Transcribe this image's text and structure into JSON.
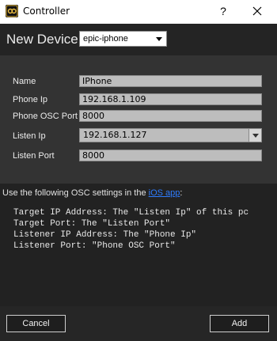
{
  "window": {
    "title": "Controller",
    "help_symbol": "?",
    "icons": {
      "app": "app-logo-icon",
      "close": "close-icon"
    }
  },
  "device": {
    "label": "New Device:",
    "selected": "epic-iphone"
  },
  "form": {
    "name_label": "Name",
    "name_value": "IPhone",
    "phone_ip_label": "Phone Ip",
    "phone_ip_value": "192.168.1.109",
    "phone_osc_port_label": "Phone OSC Port",
    "phone_osc_port_value": "8000",
    "listen_ip_label": "Listen Ip",
    "listen_ip_value": "192.168.1.127",
    "listen_port_label": "Listen Port",
    "listen_port_value": "8000"
  },
  "info": {
    "intro_prefix": "Use the following OSC settings in the ",
    "intro_link": "iOS app",
    "intro_suffix": ":",
    "lines": [
      "Target IP Address: The \"Listen Ip\" of this pc",
      "Target Port: The \"Listen Port\"",
      "Listener IP Address: The \"Phone Ip\"",
      "Listener Port: \"Phone OSC Port\""
    ]
  },
  "buttons": {
    "cancel": "Cancel",
    "add": "Add"
  },
  "colors": {
    "link": "#2e7cff",
    "field_bg": "#bdbdbd",
    "panel_bg": "#333333",
    "info_bg": "#222222"
  }
}
